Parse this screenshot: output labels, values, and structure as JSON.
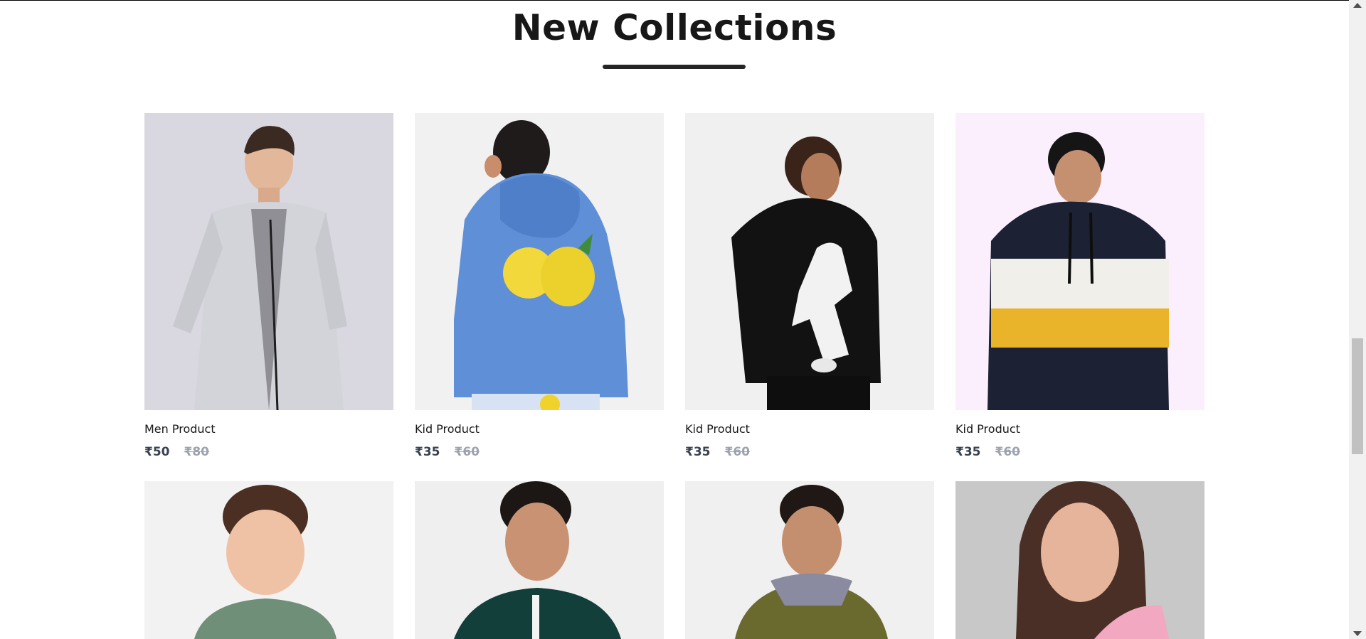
{
  "section": {
    "title": "New Collections"
  },
  "products": [
    {
      "name": "Men Product",
      "new_price": "₹50",
      "old_price": "₹80",
      "bg": "#d9d7e0",
      "image": "man-grey-zip-jacket"
    },
    {
      "name": "Kid Product",
      "new_price": "₹35",
      "old_price": "₹60",
      "bg": "#f1f1f1",
      "image": "boy-blue-lemon-hoodie"
    },
    {
      "name": "Kid Product",
      "new_price": "₹35",
      "old_price": "₹60",
      "bg": "#f0f0f0",
      "image": "boy-black-football-hoodie"
    },
    {
      "name": "Kid Product",
      "new_price": "₹35",
      "old_price": "₹60",
      "bg": "#fbeefd",
      "image": "boy-striped-hoodie"
    },
    {
      "bg": "#f2f2f2",
      "image": "boy-green-sweater"
    },
    {
      "bg": "#efefef",
      "image": "boy-teal-track-jacket"
    },
    {
      "bg": "#f0f0f0",
      "image": "boy-olive-quilted-jacket"
    },
    {
      "bg": "#c8c8c8",
      "image": "woman-pink-top"
    }
  ]
}
